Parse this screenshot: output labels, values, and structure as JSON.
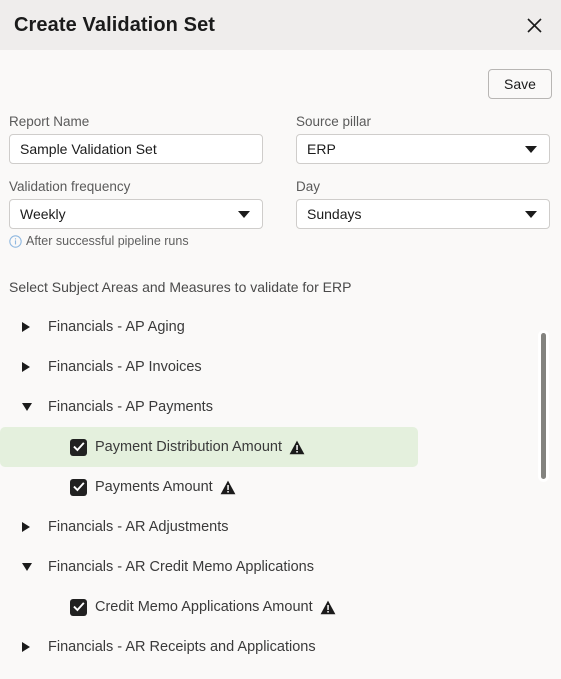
{
  "header": {
    "title": "Create Validation Set",
    "close_icon": "close-icon"
  },
  "toolbar": {
    "save_label": "Save"
  },
  "form": {
    "report_name": {
      "label": "Report Name",
      "value": "Sample Validation Set",
      "placeholder": "Report Name"
    },
    "source_pillar": {
      "label": "Source pillar",
      "value": "ERP"
    },
    "validation_frequency": {
      "label": "Validation frequency",
      "value": "Weekly",
      "hint": "After successful pipeline runs",
      "hint_icon": "info-icon"
    },
    "day": {
      "label": "Day",
      "value": "Sundays"
    }
  },
  "tree": {
    "section_title": "Select Subject Areas and Measures to validate for ERP",
    "rows": [
      {
        "label": "Financials - AP Aging",
        "type": "group",
        "expanded": false
      },
      {
        "label": "Financials - AP Invoices",
        "type": "group",
        "expanded": false
      },
      {
        "label": "Financials - AP Payments",
        "type": "group",
        "expanded": true
      },
      {
        "label": "Payment Distribution Amount",
        "type": "measure",
        "checked": true,
        "warning": true,
        "highlighted": true
      },
      {
        "label": "Payments Amount",
        "type": "measure",
        "checked": true,
        "warning": true,
        "highlighted": false
      },
      {
        "label": "Financials - AR Adjustments",
        "type": "group",
        "expanded": false
      },
      {
        "label": "Financials - AR Credit Memo Applications",
        "type": "group",
        "expanded": true
      },
      {
        "label": "Credit Memo Applications Amount",
        "type": "measure",
        "checked": true,
        "warning": true,
        "highlighted": false
      },
      {
        "label": "Financials - AR Receipts and Applications",
        "type": "group",
        "expanded": false
      }
    ]
  },
  "colors": {
    "header_bg": "#efedec",
    "body_bg": "#faf9f8",
    "highlight": "#e4f0dd",
    "checkbox": "#212121",
    "info_blue": "#8fb8e0",
    "scrollbar": "#83837f"
  }
}
